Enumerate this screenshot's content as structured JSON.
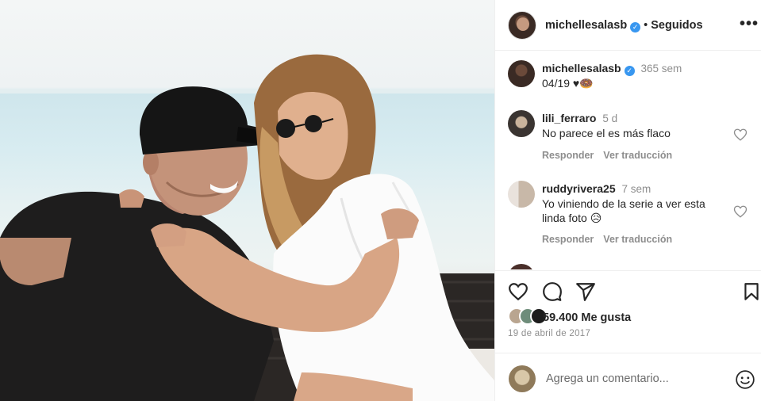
{
  "post": {
    "author": "michellesalasb",
    "verified_icon": "verified-badge-icon",
    "header_separator": "•",
    "follow_status": "Seguidos",
    "more_icon": "more-options-icon",
    "caption": {
      "user": "michellesalasb",
      "time": "365 sem",
      "text": "04/19 ♥🍩"
    },
    "comments": [
      {
        "user": "lili_ferraro",
        "time": "5 d",
        "text": "No parece el es más flaco",
        "reply_label": "Responder",
        "translate_label": "Ver traducción"
      },
      {
        "user": "ruddyrivera25",
        "time": "7 sem",
        "text": "Yo viniendo de la serie a ver esta linda foto 😥",
        "reply_label": "Responder",
        "translate_label": "Ver traducción"
      }
    ],
    "likes": "59.400 Me gusta",
    "date": "19 de abril de 2017",
    "add_comment_placeholder": "Agrega un comentario...",
    "accent_color": "#3897f0",
    "secondary_text_color": "#8e8e8e"
  }
}
